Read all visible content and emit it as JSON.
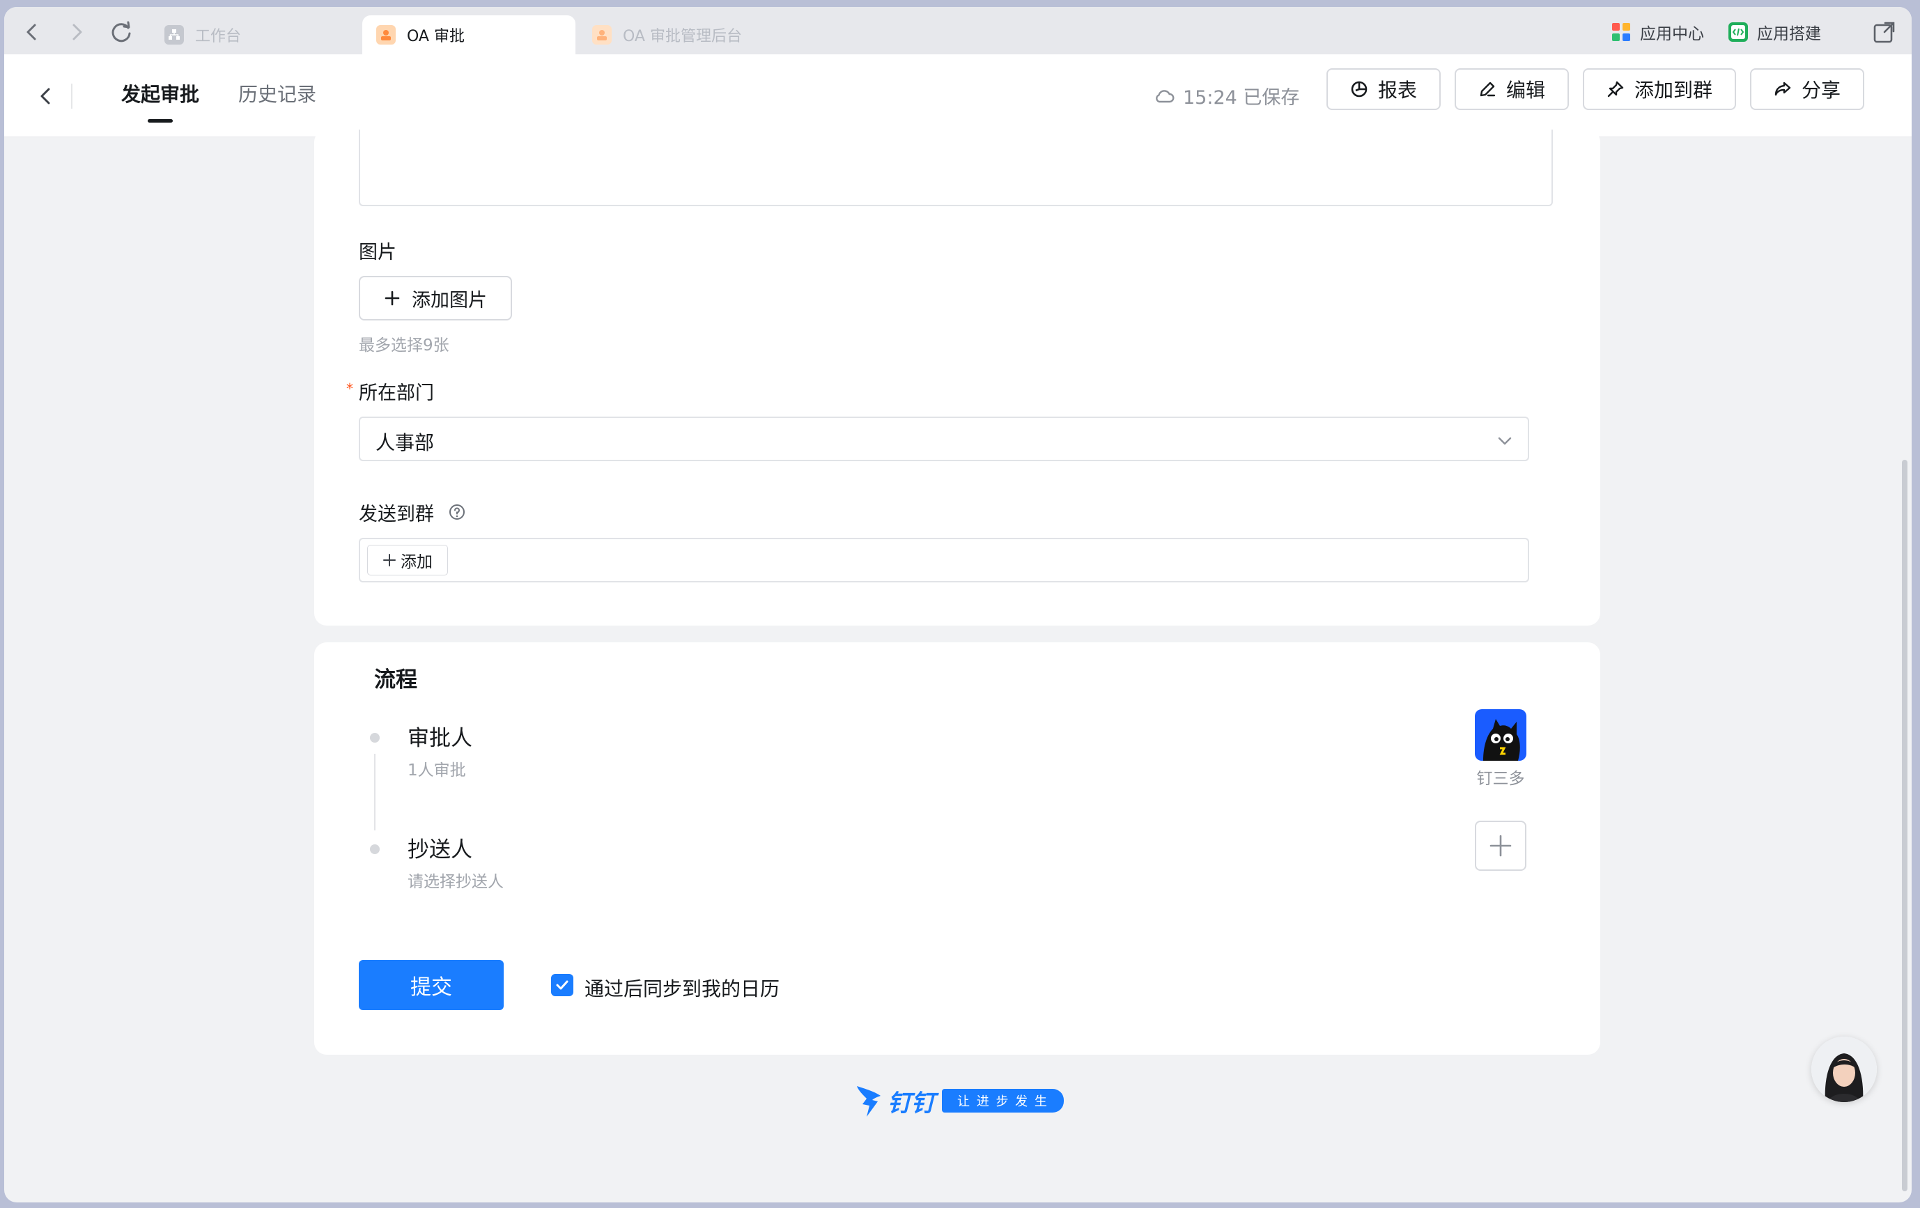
{
  "browser": {
    "tabs": [
      {
        "label": "工作台"
      },
      {
        "label": "OA 审批"
      },
      {
        "label": "OA 审批管理后台"
      }
    ],
    "tools": {
      "app_center": "应用中心",
      "app_builder": "应用搭建"
    }
  },
  "header": {
    "tabs": [
      {
        "label": "发起审批"
      },
      {
        "label": "历史记录"
      }
    ],
    "saved_status": "15:24 已保存",
    "buttons": {
      "report": "报表",
      "edit": "编辑",
      "add_to_group": "添加到群",
      "share": "分享"
    }
  },
  "form": {
    "image_label": "图片",
    "add_image_button": "添加图片",
    "image_hint": "最多选择9张",
    "department_label": "所在部门",
    "required_mark": "*",
    "department_value": "人事部",
    "send_group_label": "发送到群",
    "add_button": "添加"
  },
  "flow": {
    "title": "流程",
    "approver_title": "审批人",
    "approver_sub": "1人审批",
    "approver_name": "钉三多",
    "cc_title": "抄送人",
    "cc_sub": "请选择抄送人"
  },
  "footer": {
    "submit": "提交",
    "sync_calendar": "通过后同步到我的日历",
    "sync_checked": true,
    "brand": "钉钉",
    "slogan": "让 进 步 发 生"
  },
  "colors": {
    "accent": "#1a7dff",
    "background": "#f1f2f4"
  }
}
